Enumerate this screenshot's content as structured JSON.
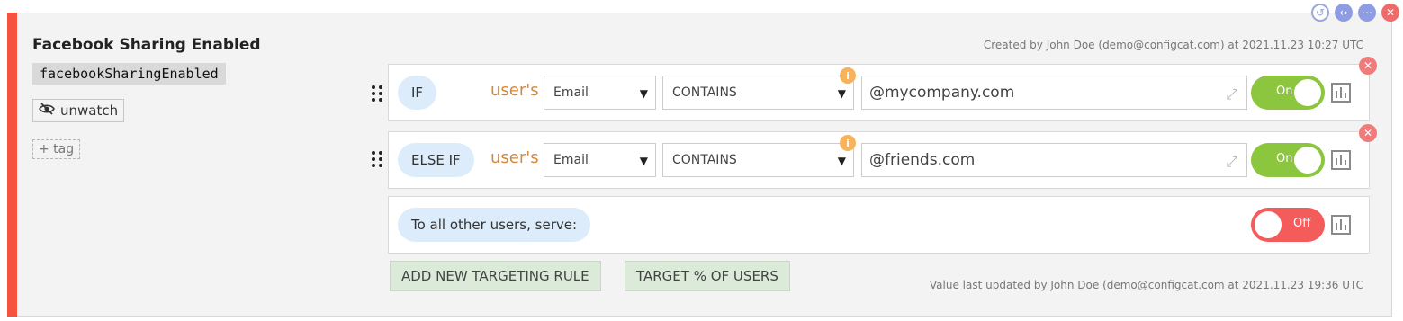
{
  "flag": {
    "title": "Facebook Sharing Enabled",
    "key": "facebookSharingEnabled",
    "unwatch_label": "unwatch",
    "tag_label": "+ tag",
    "created_text": "Created by John Doe (demo@configcat.com) at 2021.11.23 10:27 UTC",
    "updated_text": "Value last updated by John Doe (demo@configcat.com at 2021.11.23 19:36 UTC"
  },
  "rules": [
    {
      "condition": "IF",
      "users_label": "user's",
      "attribute": "Email",
      "comparator": "CONTAINS",
      "value": "@mycompany.com",
      "toggle_label": "On",
      "toggle_state": "on"
    },
    {
      "condition": "ELSE IF",
      "users_label": "user's",
      "attribute": "Email",
      "comparator": "CONTAINS",
      "value": "@friends.com",
      "toggle_label": "On",
      "toggle_state": "on"
    }
  ],
  "default_rule": {
    "label": "To all other users, serve:",
    "toggle_label": "Off",
    "toggle_state": "off"
  },
  "buttons": {
    "add_rule": "ADD NEW TARGETING RULE",
    "target_percent": "TARGET % OF USERS"
  },
  "colors": {
    "accent": "#f5533d",
    "toggle_on": "#8cc63f",
    "toggle_off": "#f45b5b",
    "condition_pill": "#dcecfb",
    "button_bg": "#dbead9",
    "users_text": "#d4883b"
  },
  "icons": {
    "history": "history-icon",
    "code": "code-icon",
    "more": "more-icon",
    "close": "close-icon",
    "eye_slash": "eye-slash-icon",
    "drag": "drag-handle-icon",
    "info": "info-icon",
    "expand": "expand-icon",
    "stats": "stats-icon",
    "delete": "delete-rule-icon"
  }
}
